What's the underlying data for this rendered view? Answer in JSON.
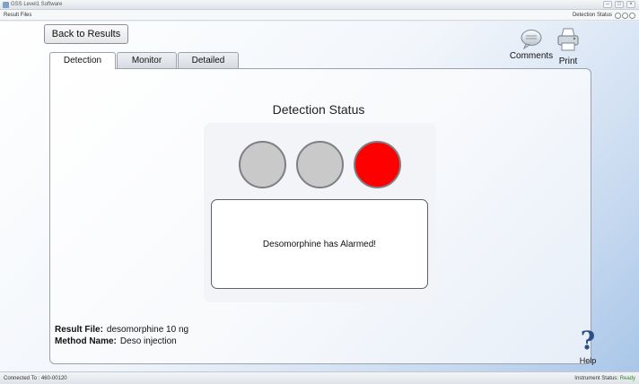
{
  "window": {
    "title": "GSS Level1 Software",
    "controls": [
      "–",
      "□",
      "×"
    ]
  },
  "menubar": {
    "left": "Result Files",
    "right": "Detection Status"
  },
  "toolbar": {
    "back_label": "Back to Results",
    "comments_label": "Comments",
    "print_label": "Print",
    "help_label": "Help",
    "help_glyph": "?"
  },
  "tabs": [
    {
      "label": "Detection",
      "active": true
    },
    {
      "label": "Monitor",
      "active": false
    },
    {
      "label": "Detailed",
      "active": false
    }
  ],
  "detection": {
    "title": "Detection Status",
    "lights": [
      {
        "state": "off",
        "color": "#c9c9c9"
      },
      {
        "state": "off",
        "color": "#c9c9c9"
      },
      {
        "state": "alarm",
        "color": "#ff0000"
      }
    ],
    "message": "Desomorphine has Alarmed!"
  },
  "result": {
    "file_label": "Result File:",
    "file_value": "desomorphine 10 ng",
    "method_label": "Method Name:",
    "method_value": "Deso injection"
  },
  "statusbar": {
    "connected": "Connected To : 460-00120",
    "instrument_label": "Instrument Status:",
    "instrument_value": "Ready"
  }
}
